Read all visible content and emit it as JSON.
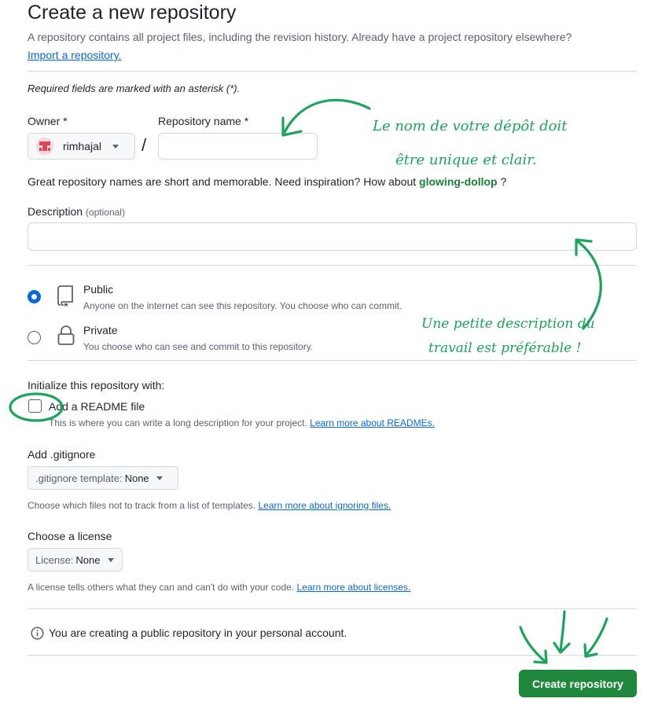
{
  "header": {
    "title": "Create a new repository",
    "intro": "A repository contains all project files, including the revision history. Already have a project repository elsewhere?",
    "import_link": "Import a repository."
  },
  "required_note": "Required fields are marked with an asterisk (*).",
  "owner": {
    "label": "Owner *",
    "value": "rimhajal",
    "separator": "/"
  },
  "repo_name": {
    "label": "Repository name *",
    "value": "",
    "hint_prefix": "Great repository names are short and memorable. Need inspiration? How about",
    "suggestion": "glowing-dollop",
    "hint_suffix": "?"
  },
  "description": {
    "label": "Description",
    "optional": "(optional)",
    "value": ""
  },
  "visibility": {
    "options": [
      {
        "label": "Public",
        "desc": "Anyone on the internet can see this repository. You choose who can commit.",
        "selected": true,
        "icon": "repo-icon"
      },
      {
        "label": "Private",
        "desc": "You choose who can see and commit to this repository.",
        "selected": false,
        "icon": "lock-icon"
      }
    ]
  },
  "init": {
    "heading": "Initialize this repository with:",
    "readme_label": "Add a README file",
    "readme_checked": false,
    "readme_desc": "This is where you can write a long description for your project.",
    "readme_link": "Learn more about READMEs."
  },
  "gitignore": {
    "heading": "Add .gitignore",
    "select_prefix": ".gitignore template:",
    "select_value": "None",
    "desc": "Choose which files not to track from a list of templates.",
    "link": "Learn more about ignoring files."
  },
  "license": {
    "heading": "Choose a license",
    "select_prefix": "License:",
    "select_value": "None",
    "desc": "A license tells others what they can and can't do with your code.",
    "link": "Learn more about licenses."
  },
  "notice": {
    "text": "You are creating a public repository in your personal account.",
    "icon": "info-icon"
  },
  "submit_label": "Create repository",
  "annotations": {
    "name_line1": "Le nom de votre dépôt doit",
    "name_line2": "être unique et clair.",
    "desc_line1": "Une petite description du",
    "desc_line2": "travail est préférable !",
    "color": "#1aa55a"
  },
  "colors": {
    "primary_button": "#1f883d",
    "link": "#0969da",
    "border": "#d1d9e0"
  }
}
